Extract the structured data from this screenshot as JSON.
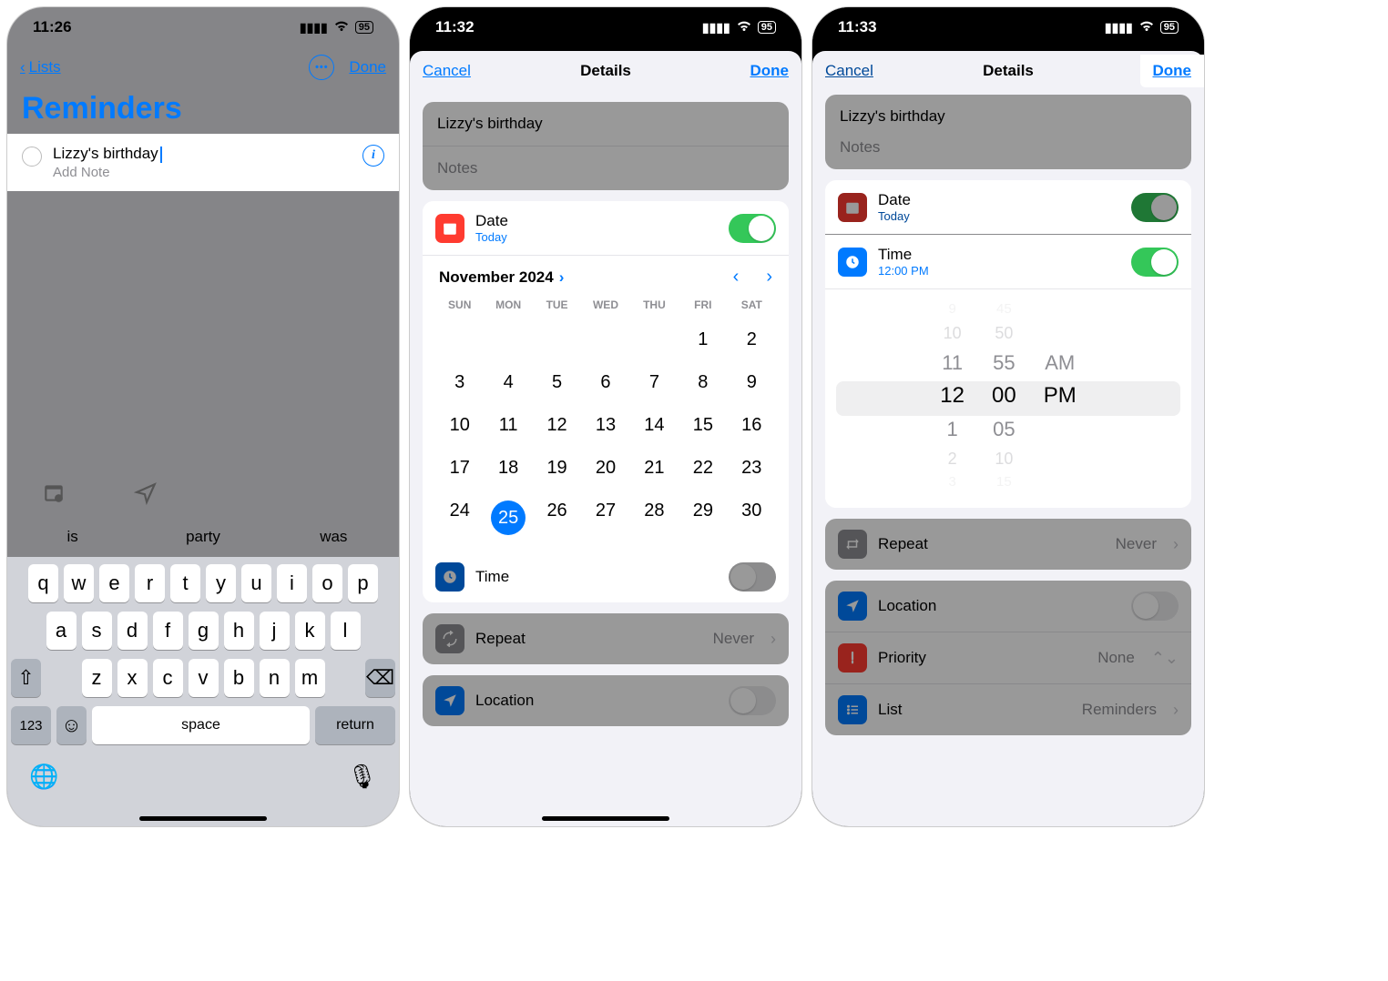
{
  "screen1": {
    "time": "11:26",
    "battery": "95",
    "back_label": "Lists",
    "done_label": "Done",
    "page_title": "Reminders",
    "reminder_title": "Lizzy's birthday",
    "add_note_placeholder": "Add Note",
    "suggestions": [
      "is",
      "party",
      "was"
    ],
    "kb_rows": {
      "r1": [
        "q",
        "w",
        "e",
        "r",
        "t",
        "y",
        "u",
        "i",
        "o",
        "p"
      ],
      "r2": [
        "a",
        "s",
        "d",
        "f",
        "g",
        "h",
        "j",
        "k",
        "l"
      ],
      "r3": [
        "z",
        "x",
        "c",
        "v",
        "b",
        "n",
        "m"
      ]
    },
    "kb_123": "123",
    "kb_space": "space",
    "kb_return": "return"
  },
  "screen2": {
    "time": "11:32",
    "battery": "95",
    "cancel": "Cancel",
    "title": "Details",
    "done": "Done",
    "reminder_title": "Lizzy's birthday",
    "notes_placeholder": "Notes",
    "date_label": "Date",
    "date_sub": "Today",
    "time_label": "Time",
    "repeat_label": "Repeat",
    "repeat_value": "Never",
    "location_label": "Location",
    "cal_month": "November 2024",
    "dow": [
      "SUN",
      "MON",
      "TUE",
      "WED",
      "THU",
      "FRI",
      "SAT"
    ],
    "days_row1": [
      "",
      "",
      "",
      "",
      "",
      "1",
      "2"
    ],
    "days_row2": [
      "3",
      "4",
      "5",
      "6",
      "7",
      "8",
      "9"
    ],
    "days_row3": [
      "10",
      "11",
      "12",
      "13",
      "14",
      "15",
      "16"
    ],
    "days_row4": [
      "17",
      "18",
      "19",
      "20",
      "21",
      "22",
      "23"
    ],
    "days_row5": [
      "24",
      "25",
      "26",
      "27",
      "28",
      "29",
      "30"
    ],
    "selected_day": "25"
  },
  "screen3": {
    "time": "11:33",
    "battery": "95",
    "cancel": "Cancel",
    "title": "Details",
    "done": "Done",
    "reminder_title": "Lizzy's birthday",
    "notes_placeholder": "Notes",
    "date_label": "Date",
    "date_sub": "Today",
    "time_label": "Time",
    "time_sub": "12:00 PM",
    "repeat_label": "Repeat",
    "repeat_value": "Never",
    "location_label": "Location",
    "priority_label": "Priority",
    "priority_value": "None",
    "list_label": "List",
    "list_value": "Reminders",
    "picker": {
      "hours": [
        "9",
        "10",
        "11",
        "12",
        "1",
        "2",
        "3"
      ],
      "mins": [
        "45",
        "50",
        "55",
        "00",
        "05",
        "10",
        "15"
      ],
      "ampm": [
        "AM",
        "PM"
      ]
    }
  }
}
